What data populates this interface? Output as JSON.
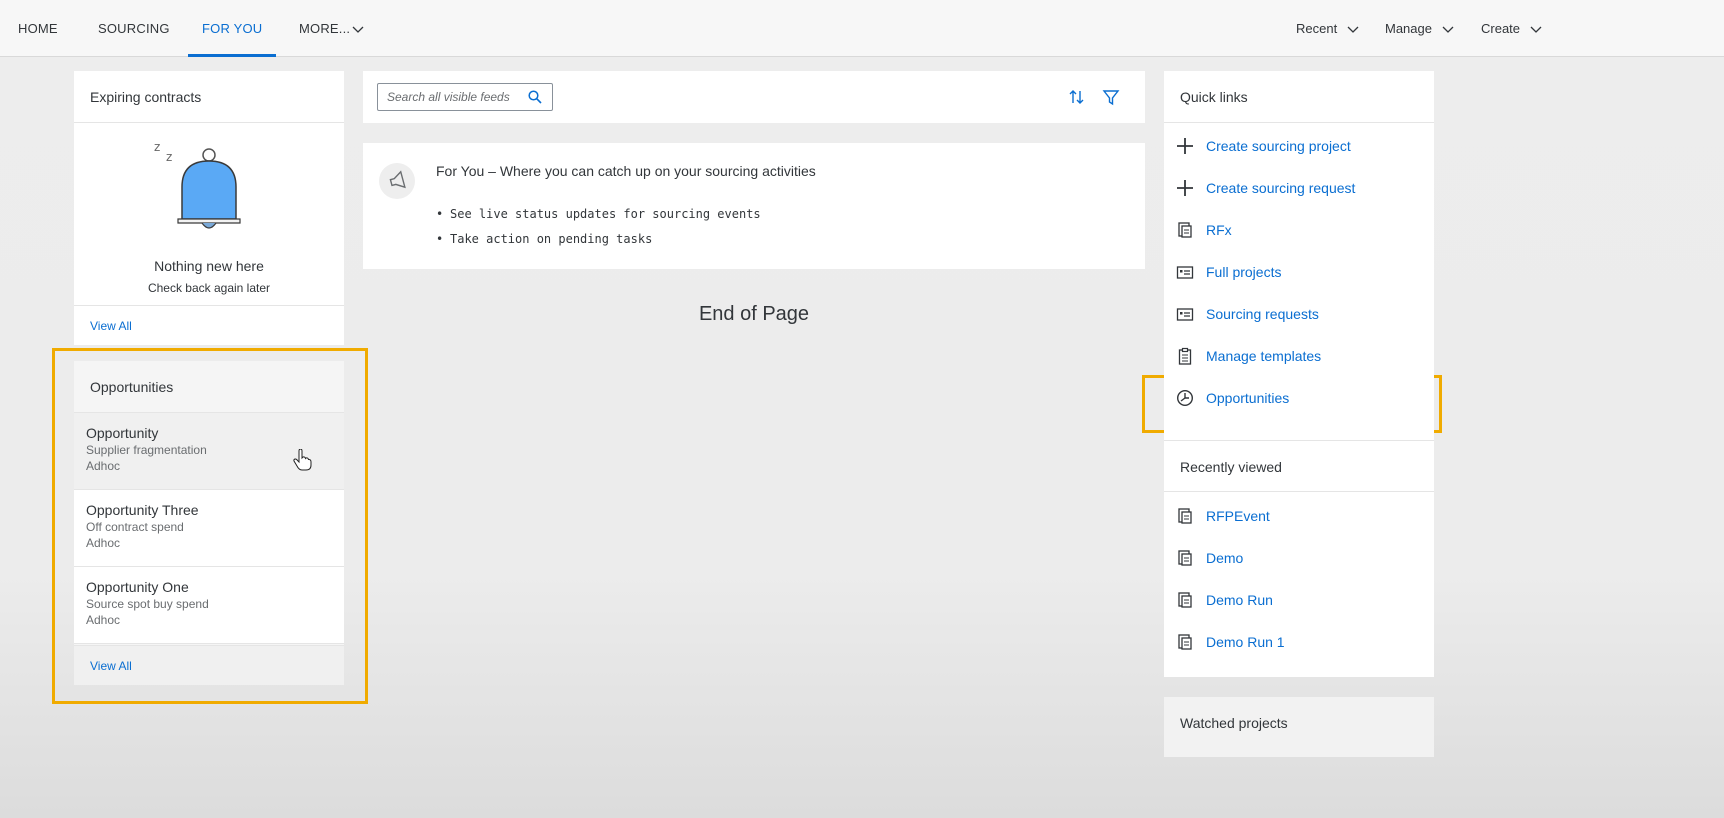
{
  "topnav": {
    "tabs": [
      {
        "label": "HOME"
      },
      {
        "label": "SOURCING"
      },
      {
        "label": "FOR YOU"
      },
      {
        "label": "MORE..."
      }
    ],
    "right": [
      {
        "label": "Recent"
      },
      {
        "label": "Manage"
      },
      {
        "label": "Create"
      }
    ]
  },
  "expiring": {
    "title": "Expiring contracts",
    "empty_title": "Nothing new here",
    "empty_sub": "Check back again later",
    "view_all": "View All",
    "zz": "z z"
  },
  "opportunities": {
    "title": "Opportunities",
    "items": [
      {
        "title": "Opportunity",
        "sub1": "Supplier fragmentation",
        "sub2": "Adhoc"
      },
      {
        "title": "Opportunity Three",
        "sub1": "Off contract spend",
        "sub2": "Adhoc"
      },
      {
        "title": "Opportunity One",
        "sub1": "Source spot buy spend",
        "sub2": "Adhoc"
      }
    ],
    "view_all": "View All"
  },
  "feed": {
    "search_placeholder": "Search all visible feeds",
    "title": "For You – Where you can catch up on your sourcing activities",
    "bullets": [
      "See live status updates for sourcing events",
      "Take action on pending tasks"
    ],
    "end_of_page": "End of Page"
  },
  "quick_links": {
    "title": "Quick links",
    "items": [
      {
        "label": "Create sourcing project",
        "icon": "plus-icon"
      },
      {
        "label": "Create sourcing request",
        "icon": "plus-icon"
      },
      {
        "label": "RFx",
        "icon": "document-icon"
      },
      {
        "label": "Full projects",
        "icon": "card-icon"
      },
      {
        "label": "Sourcing requests",
        "icon": "card-icon"
      },
      {
        "label": "Manage templates",
        "icon": "clipboard-icon"
      },
      {
        "label": "Opportunities",
        "icon": "opportunity-icon"
      }
    ]
  },
  "recently_viewed": {
    "title": "Recently viewed",
    "items": [
      {
        "label": "RFPEvent"
      },
      {
        "label": "Demo"
      },
      {
        "label": "Demo Run"
      },
      {
        "label": "Demo Run 1"
      }
    ]
  },
  "watched": {
    "title": "Watched projects"
  },
  "colors": {
    "accent": "#0a6ed1",
    "highlight": "#f0ab00"
  }
}
